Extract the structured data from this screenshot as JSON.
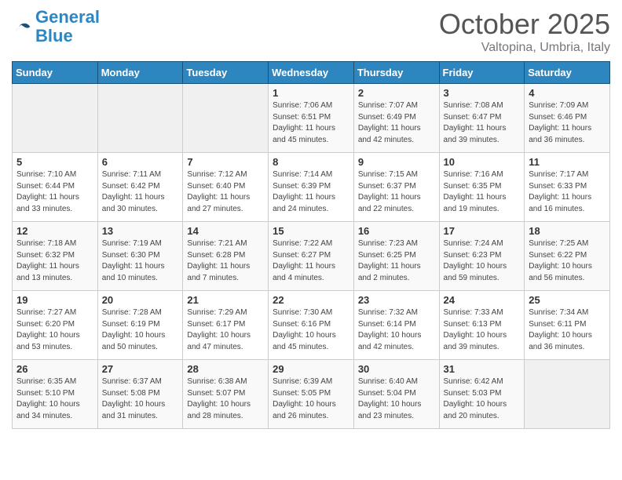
{
  "header": {
    "logo_line1": "General",
    "logo_line2": "Blue",
    "month": "October 2025",
    "location": "Valtopina, Umbria, Italy"
  },
  "weekdays": [
    "Sunday",
    "Monday",
    "Tuesday",
    "Wednesday",
    "Thursday",
    "Friday",
    "Saturday"
  ],
  "weeks": [
    [
      {
        "day": "",
        "info": ""
      },
      {
        "day": "",
        "info": ""
      },
      {
        "day": "",
        "info": ""
      },
      {
        "day": "1",
        "info": "Sunrise: 7:06 AM\nSunset: 6:51 PM\nDaylight: 11 hours\nand 45 minutes."
      },
      {
        "day": "2",
        "info": "Sunrise: 7:07 AM\nSunset: 6:49 PM\nDaylight: 11 hours\nand 42 minutes."
      },
      {
        "day": "3",
        "info": "Sunrise: 7:08 AM\nSunset: 6:47 PM\nDaylight: 11 hours\nand 39 minutes."
      },
      {
        "day": "4",
        "info": "Sunrise: 7:09 AM\nSunset: 6:46 PM\nDaylight: 11 hours\nand 36 minutes."
      }
    ],
    [
      {
        "day": "5",
        "info": "Sunrise: 7:10 AM\nSunset: 6:44 PM\nDaylight: 11 hours\nand 33 minutes."
      },
      {
        "day": "6",
        "info": "Sunrise: 7:11 AM\nSunset: 6:42 PM\nDaylight: 11 hours\nand 30 minutes."
      },
      {
        "day": "7",
        "info": "Sunrise: 7:12 AM\nSunset: 6:40 PM\nDaylight: 11 hours\nand 27 minutes."
      },
      {
        "day": "8",
        "info": "Sunrise: 7:14 AM\nSunset: 6:39 PM\nDaylight: 11 hours\nand 24 minutes."
      },
      {
        "day": "9",
        "info": "Sunrise: 7:15 AM\nSunset: 6:37 PM\nDaylight: 11 hours\nand 22 minutes."
      },
      {
        "day": "10",
        "info": "Sunrise: 7:16 AM\nSunset: 6:35 PM\nDaylight: 11 hours\nand 19 minutes."
      },
      {
        "day": "11",
        "info": "Sunrise: 7:17 AM\nSunset: 6:33 PM\nDaylight: 11 hours\nand 16 minutes."
      }
    ],
    [
      {
        "day": "12",
        "info": "Sunrise: 7:18 AM\nSunset: 6:32 PM\nDaylight: 11 hours\nand 13 minutes."
      },
      {
        "day": "13",
        "info": "Sunrise: 7:19 AM\nSunset: 6:30 PM\nDaylight: 11 hours\nand 10 minutes."
      },
      {
        "day": "14",
        "info": "Sunrise: 7:21 AM\nSunset: 6:28 PM\nDaylight: 11 hours\nand 7 minutes."
      },
      {
        "day": "15",
        "info": "Sunrise: 7:22 AM\nSunset: 6:27 PM\nDaylight: 11 hours\nand 4 minutes."
      },
      {
        "day": "16",
        "info": "Sunrise: 7:23 AM\nSunset: 6:25 PM\nDaylight: 11 hours\nand 2 minutes."
      },
      {
        "day": "17",
        "info": "Sunrise: 7:24 AM\nSunset: 6:23 PM\nDaylight: 10 hours\nand 59 minutes."
      },
      {
        "day": "18",
        "info": "Sunrise: 7:25 AM\nSunset: 6:22 PM\nDaylight: 10 hours\nand 56 minutes."
      }
    ],
    [
      {
        "day": "19",
        "info": "Sunrise: 7:27 AM\nSunset: 6:20 PM\nDaylight: 10 hours\nand 53 minutes."
      },
      {
        "day": "20",
        "info": "Sunrise: 7:28 AM\nSunset: 6:19 PM\nDaylight: 10 hours\nand 50 minutes."
      },
      {
        "day": "21",
        "info": "Sunrise: 7:29 AM\nSunset: 6:17 PM\nDaylight: 10 hours\nand 47 minutes."
      },
      {
        "day": "22",
        "info": "Sunrise: 7:30 AM\nSunset: 6:16 PM\nDaylight: 10 hours\nand 45 minutes."
      },
      {
        "day": "23",
        "info": "Sunrise: 7:32 AM\nSunset: 6:14 PM\nDaylight: 10 hours\nand 42 minutes."
      },
      {
        "day": "24",
        "info": "Sunrise: 7:33 AM\nSunset: 6:13 PM\nDaylight: 10 hours\nand 39 minutes."
      },
      {
        "day": "25",
        "info": "Sunrise: 7:34 AM\nSunset: 6:11 PM\nDaylight: 10 hours\nand 36 minutes."
      }
    ],
    [
      {
        "day": "26",
        "info": "Sunrise: 6:35 AM\nSunset: 5:10 PM\nDaylight: 10 hours\nand 34 minutes."
      },
      {
        "day": "27",
        "info": "Sunrise: 6:37 AM\nSunset: 5:08 PM\nDaylight: 10 hours\nand 31 minutes."
      },
      {
        "day": "28",
        "info": "Sunrise: 6:38 AM\nSunset: 5:07 PM\nDaylight: 10 hours\nand 28 minutes."
      },
      {
        "day": "29",
        "info": "Sunrise: 6:39 AM\nSunset: 5:05 PM\nDaylight: 10 hours\nand 26 minutes."
      },
      {
        "day": "30",
        "info": "Sunrise: 6:40 AM\nSunset: 5:04 PM\nDaylight: 10 hours\nand 23 minutes."
      },
      {
        "day": "31",
        "info": "Sunrise: 6:42 AM\nSunset: 5:03 PM\nDaylight: 10 hours\nand 20 minutes."
      },
      {
        "day": "",
        "info": ""
      }
    ]
  ]
}
